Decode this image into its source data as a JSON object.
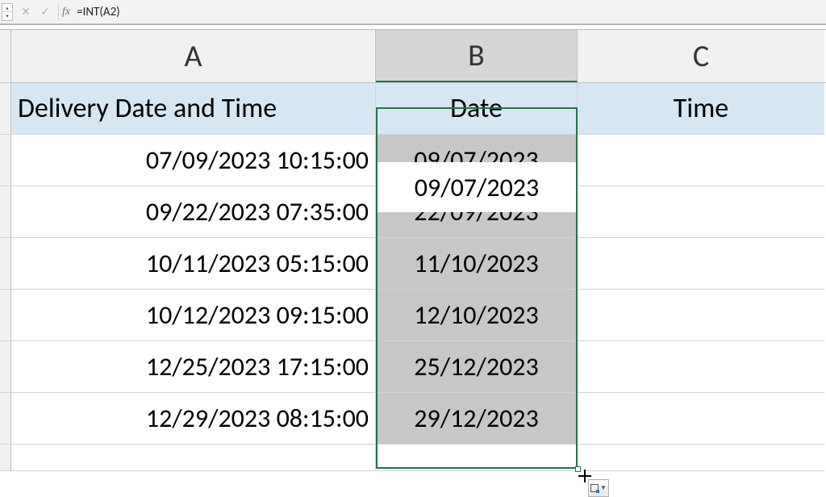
{
  "formula_bar": {
    "fx_label": "fx",
    "formula": "=INT(A2)"
  },
  "columns": {
    "a": "A",
    "b": "B",
    "c": "C"
  },
  "headers": {
    "a": "Delivery Date and Time",
    "b": "Date",
    "c": "Time"
  },
  "rows": [
    {
      "a": "07/09/2023 10:15:00",
      "b": "09/07/2023",
      "c": ""
    },
    {
      "a": "09/22/2023 07:35:00",
      "b": "22/09/2023",
      "c": ""
    },
    {
      "a": "10/11/2023 05:15:00",
      "b": "11/10/2023",
      "c": ""
    },
    {
      "a": "10/12/2023 09:15:00",
      "b": "12/10/2023",
      "c": ""
    },
    {
      "a": "12/25/2023 17:15:00",
      "b": "25/12/2023",
      "c": ""
    },
    {
      "a": "12/29/2023 08:15:00",
      "b": "29/12/2023",
      "c": ""
    }
  ]
}
